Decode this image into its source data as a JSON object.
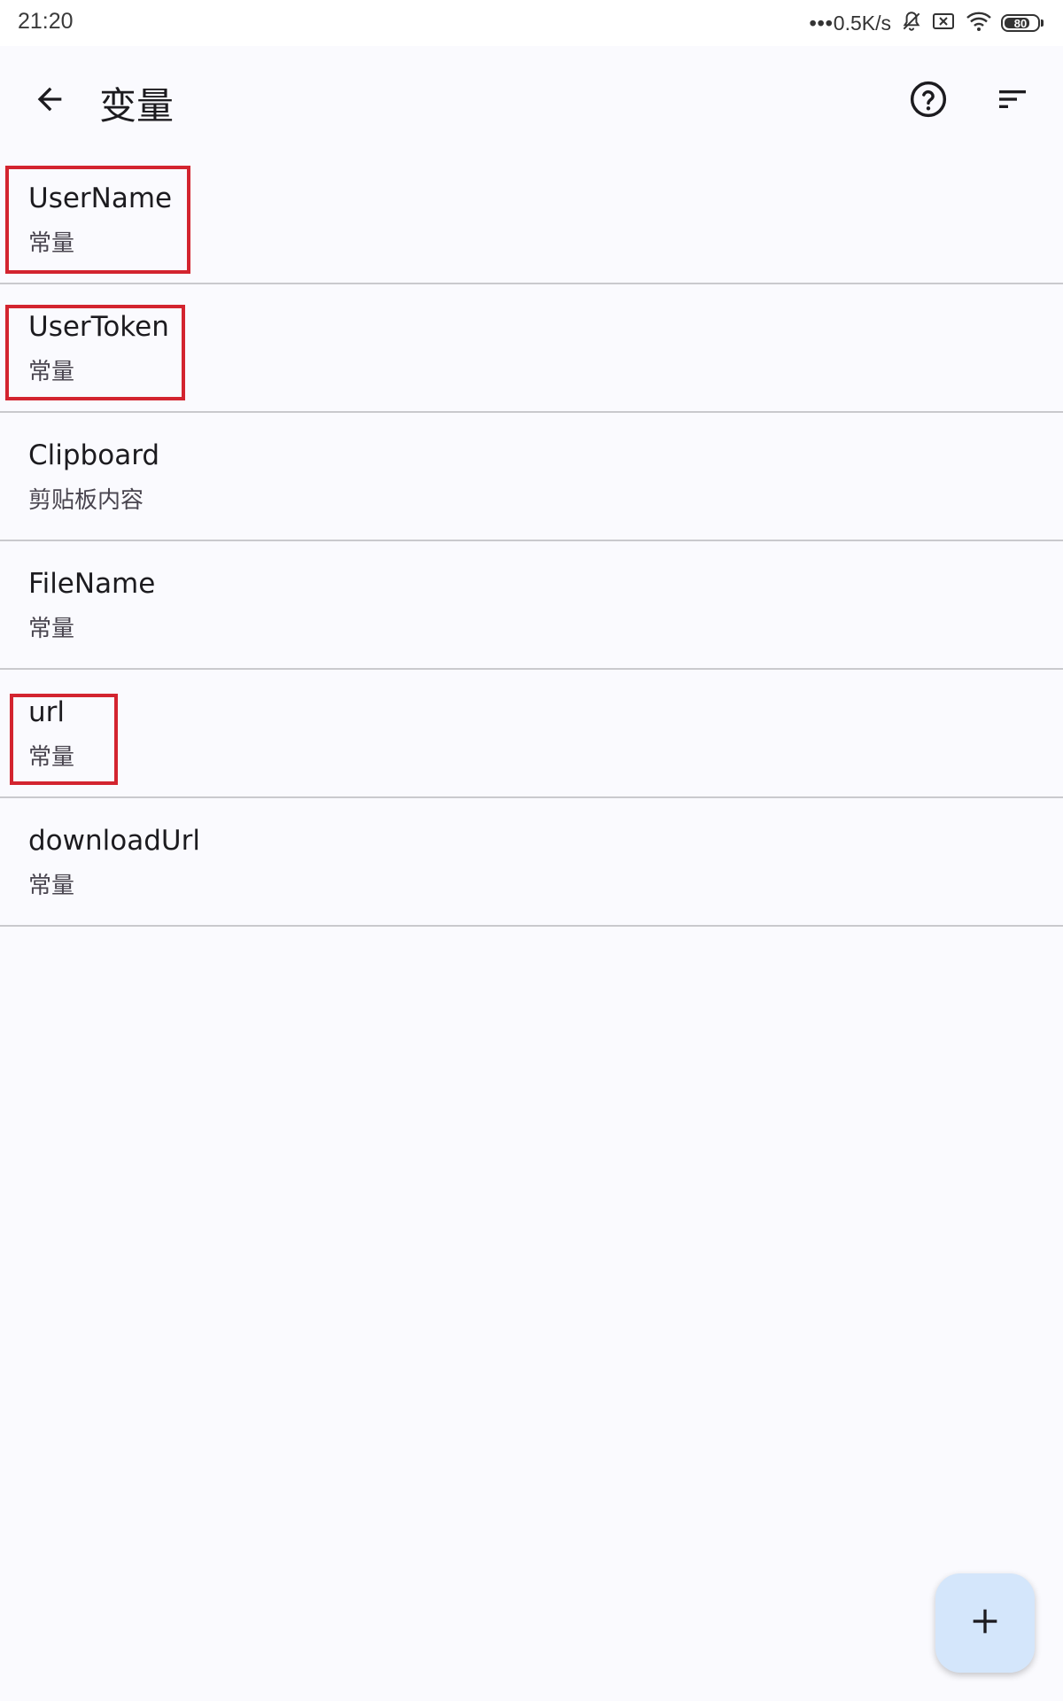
{
  "status_bar": {
    "time": "21:20",
    "net_speed": "0.5K/s",
    "battery_level": "80"
  },
  "app_bar": {
    "title": "变量",
    "back_icon": "arrow-back-icon",
    "help_icon": "help-circle-icon",
    "sort_icon": "sort-icon"
  },
  "variables": [
    {
      "name": "UserName",
      "type": "常量"
    },
    {
      "name": "UserToken",
      "type": "常量"
    },
    {
      "name": "Clipboard",
      "type": "剪贴板内容"
    },
    {
      "name": "FileName",
      "type": "常量"
    },
    {
      "name": "url",
      "type": "常量"
    },
    {
      "name": "downloadUrl",
      "type": "常量"
    }
  ],
  "fab": {
    "icon": "plus-icon"
  },
  "colors": {
    "background": "#fafafe",
    "divider": "#c9c9cd",
    "highlight": "#d3242f",
    "fab": "#d4e6fb"
  }
}
